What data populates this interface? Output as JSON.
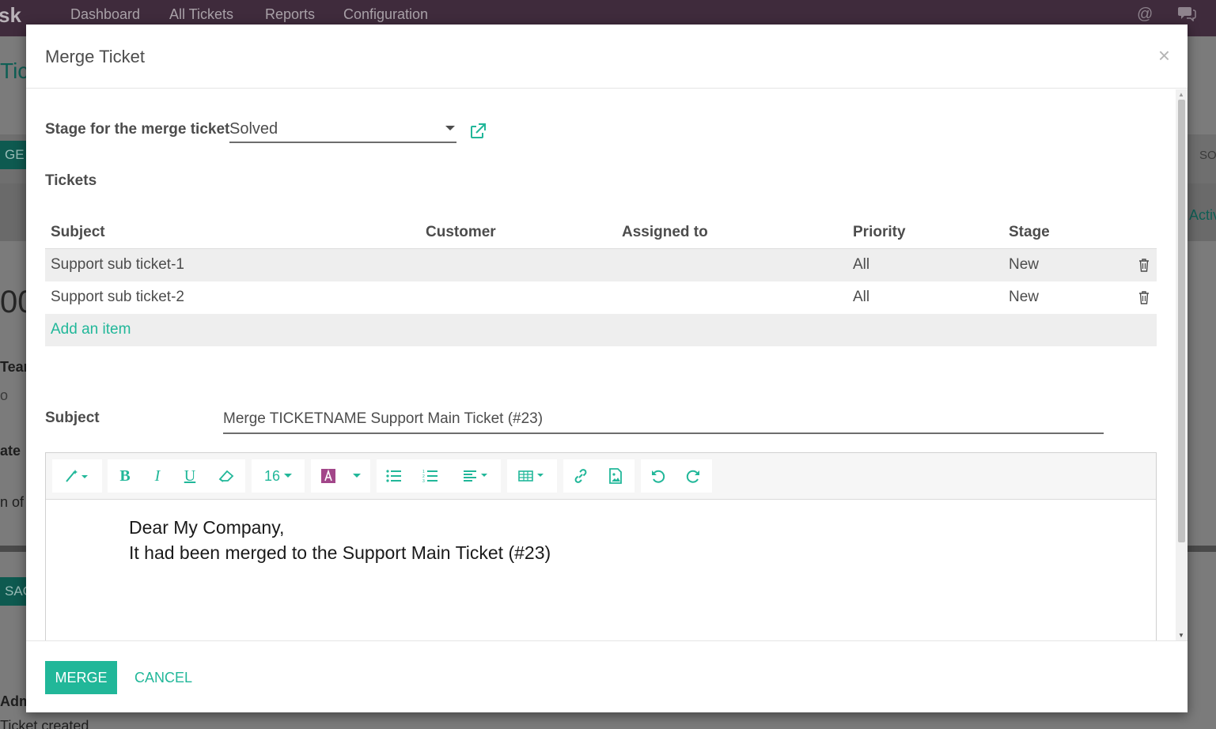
{
  "background": {
    "brand_fragment": "sk",
    "nav": [
      "Dashboard",
      "All Tickets",
      "Reports",
      "Configuration"
    ],
    "title_fragment": "Tic",
    "button_fragment": "GE T",
    "right_button_fragment": "SO",
    "right_label_fragment": "Activ",
    "big_fragment": "00",
    "team_fragment": "Team",
    "o_fragment": "o",
    "date_fragment": "ate",
    "of_fragment": "n of",
    "msg_fragment": "SAG",
    "adm_fragment": "Adm",
    "created_fragment": "Ticket created"
  },
  "modal": {
    "title": "Merge Ticket",
    "close": "×",
    "stage_label": "Stage for the merge ticket",
    "stage_value": "Solved",
    "tickets_label": "Tickets",
    "columns": [
      "Subject",
      "Customer",
      "Assigned to",
      "Priority",
      "Stage"
    ],
    "rows": [
      {
        "subject": "Support sub ticket-1",
        "customer": "",
        "assigned": "",
        "priority": "All",
        "stage": "New"
      },
      {
        "subject": "Support sub ticket-2",
        "customer": "",
        "assigned": "",
        "priority": "All",
        "stage": "New"
      }
    ],
    "add_item": "Add an item",
    "subject_label": "Subject",
    "subject_value": "Merge TICKETNAME Support Main Ticket (#23)",
    "font_size": "16",
    "body_lines": [
      "Dear My Company,",
      "It had been merged to the Support Main Ticket (#23)"
    ],
    "merge_label": "MERGE",
    "cancel_label": "CANCEL"
  },
  "colors": {
    "accent": "#21b799",
    "topbar": "#3f2b3c",
    "font_color_icon": "#a24689"
  }
}
